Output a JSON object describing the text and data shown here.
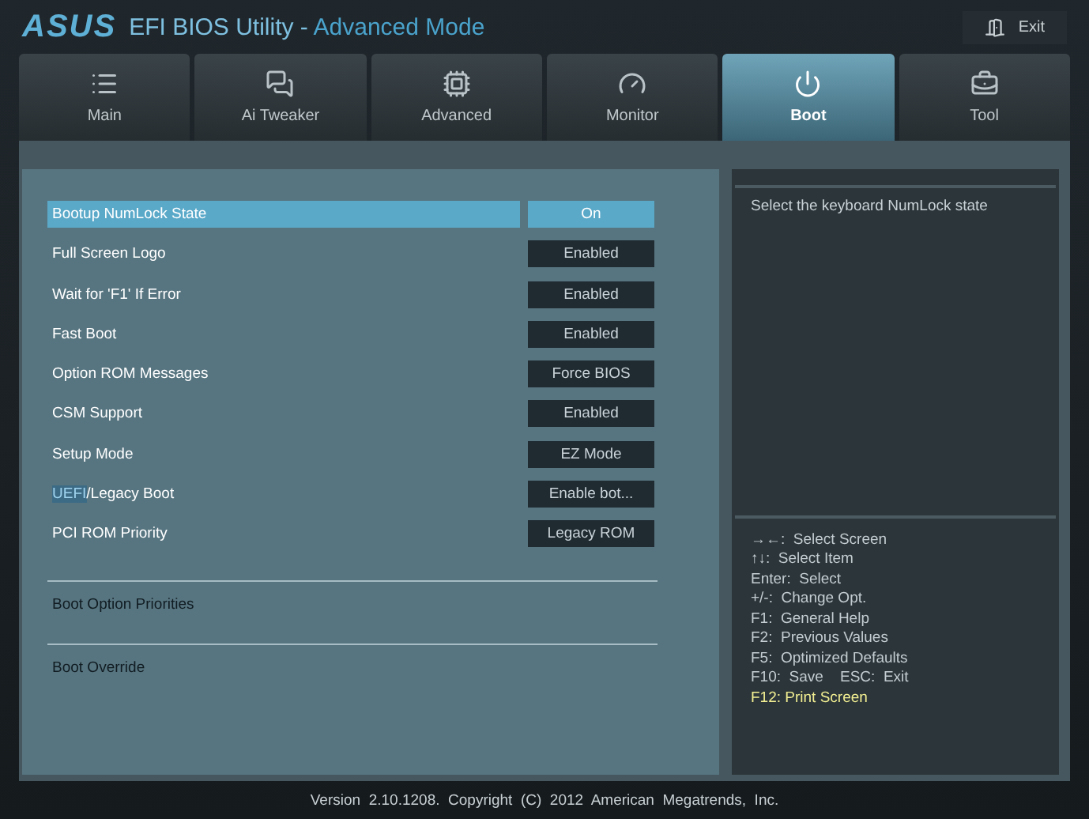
{
  "window": {
    "logo": "ASUS",
    "title": "EFI BIOS Utility - ",
    "mode": "Advanced Mode",
    "exit": "Exit"
  },
  "tabs": [
    {
      "label": "Main",
      "selected": false
    },
    {
      "label": "Ai  Tweaker",
      "selected": false
    },
    {
      "label": "Advanced",
      "selected": false
    },
    {
      "label": "Monitor",
      "selected": false
    },
    {
      "label": "Boot",
      "selected": true
    },
    {
      "label": "Tool",
      "selected": false
    }
  ],
  "settings": [
    {
      "label_parts": [
        {
          "text": "Bootup NumLock State",
          "highlighted": false
        }
      ],
      "value": "On",
      "selected": true
    },
    {
      "label_parts": [
        {
          "text": "Full Screen Logo",
          "highlighted": false
        }
      ],
      "value": "Enabled",
      "selected": false
    },
    {
      "label_parts": [
        {
          "text": "Wait for 'F1' If Error",
          "highlighted": false
        }
      ],
      "value": "Enabled",
      "selected": false
    },
    {
      "label_parts": [
        {
          "text": "Fast Boot",
          "highlighted": false
        }
      ],
      "value": "Enabled",
      "selected": false
    },
    {
      "label_parts": [
        {
          "text": "Option ROM Messages",
          "highlighted": false
        }
      ],
      "value": "Force BIOS",
      "selected": false
    },
    {
      "label_parts": [
        {
          "text": "CSM Support",
          "highlighted": false
        }
      ],
      "value": "Enabled",
      "selected": false
    },
    {
      "label_parts": [
        {
          "text": "Setup Mode",
          "highlighted": false
        }
      ],
      "value": "EZ Mode",
      "selected": false
    },
    {
      "label_parts": [
        {
          "text": "UEFI",
          "highlighted": true
        },
        {
          "text": "/Legacy Boot",
          "highlighted": false
        }
      ],
      "value": "Enable bot...",
      "selected": false
    },
    {
      "label_parts": [
        {
          "text": "PCI ROM Priority",
          "highlighted": false
        }
      ],
      "value": "Legacy ROM",
      "selected": false
    }
  ],
  "submenus": [
    "Boot Option Priorities",
    "Boot Override"
  ],
  "help": {
    "description": "Select the keyboard NumLock state",
    "keys": [
      {
        "text": "→←:  Select Screen",
        "highlighted": false
      },
      {
        "text": "↑↓:  Select Item",
        "highlighted": false
      },
      {
        "text": "Enter:  Select",
        "highlighted": false
      },
      {
        "text": "+/-:  Change Opt.",
        "highlighted": false
      },
      {
        "text": "F1:  General Help",
        "highlighted": false
      },
      {
        "text": "F2:  Previous Values",
        "highlighted": false
      },
      {
        "text": "F5:  Optimized Defaults",
        "highlighted": false
      },
      {
        "text": "F10:  Save    ESC:  Exit",
        "highlighted": false
      },
      {
        "text": "F12: Print Screen",
        "highlighted": true
      }
    ]
  },
  "status_bar": "Version  2.10.1208.  Copyright  (C)  2012  American  Megatrends,  Inc."
}
